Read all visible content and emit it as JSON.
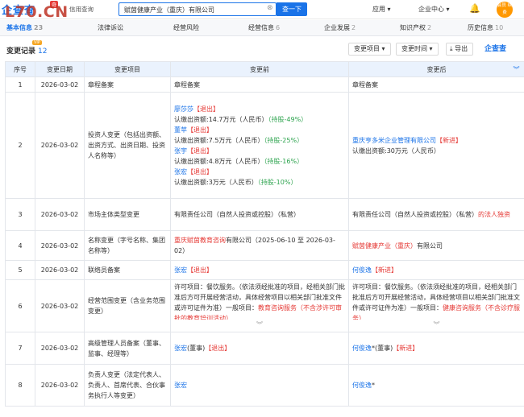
{
  "watermark": "L70.CN",
  "header": {
    "logo": "企查查",
    "logo_badge": "奇",
    "credit_label": "信用查询",
    "search_value": "赋茵健康产业（重庆）有限公司",
    "search_button": "查一下",
    "app_label": "应用 ▾",
    "enterprise_center": "企业中心 ▾",
    "member_badge": "会员 续费"
  },
  "tabs": [
    {
      "label": "基本信息",
      "count": "23",
      "active": true
    },
    {
      "label": "法律诉讼",
      "count": ""
    },
    {
      "label": "经营风险",
      "count": ""
    },
    {
      "label": "经营信息",
      "count": "6"
    },
    {
      "label": "企业发展",
      "count": "2"
    },
    {
      "label": "知识产权",
      "count": "2"
    },
    {
      "label": "历史信息",
      "count": "10"
    }
  ],
  "section": {
    "title": "变更记录",
    "count": "12",
    "vip": "VIP",
    "filter_type": "变更项目 ▾",
    "filter_time": "变更时间 ▾",
    "export": "导出",
    "brand": "企查查"
  },
  "table": {
    "headers": [
      "序号",
      "变更日期",
      "变更项目",
      "变更前",
      "变更后"
    ],
    "rows": [
      {
        "no": "1",
        "date": "2026-03-02",
        "item": "章程备案",
        "before": [
          {
            "t": "章程备案",
            "c": ""
          }
        ],
        "after": [
          {
            "t": "章程备案",
            "c": ""
          }
        ]
      },
      {
        "no": "2",
        "date": "2026-03-02",
        "item": "投资人变更（包括出资额、出资方式、出资日期、投资人名称等）",
        "before": [
          {
            "t": "廖莎莎",
            "c": "blue",
            "s": "【退出】"
          },
          {
            "t": "认缴出资额:14.7万元（人民币）",
            "c": "",
            "s": "（持股-49%）",
            "sc": "green"
          },
          {
            "t": "董苹",
            "c": "blue",
            "s": "【退出】"
          },
          {
            "t": "认缴出资额:7.5万元（人民币）",
            "c": "",
            "s": "（持股-25%）",
            "sc": "green"
          },
          {
            "t": "张宇",
            "c": "blue",
            "s": "【退出】"
          },
          {
            "t": "认缴出资额:4.8万元（人民币）",
            "c": "",
            "s": "（持股-16%）",
            "sc": "green"
          },
          {
            "t": "张宏",
            "c": "blue",
            "s": "【退出】"
          },
          {
            "t": "认缴出资额:3万元（人民币）",
            "c": "",
            "s": "（持股-10%）",
            "sc": "green"
          }
        ],
        "after": [
          {
            "t": "重庆亨多米企业管理有限公司",
            "c": "blue",
            "s": "【新进】"
          },
          {
            "t": "认缴出资额:30万元（人民币）",
            "c": ""
          }
        ]
      },
      {
        "no": "3",
        "date": "2026-03-02",
        "item": "市场主体类型变更",
        "before": [
          {
            "t": "有限责任公司（自然人投资或控股）（私营）",
            "c": ""
          }
        ],
        "after": [
          {
            "t": "有限责任公司（自然人投资或控股",
            "c": "",
            "s": "的法人独资",
            "sc": "red",
            "e": "）（私营）"
          }
        ]
      },
      {
        "no": "4",
        "date": "2026-03-02",
        "item": "名称变更（字号名称、集团名称等）",
        "before": [
          {
            "t": "重庆赋茵教育咨询",
            "c": "red",
            "e": "有限公司（2025-06-10 至 2026-03-02）"
          }
        ],
        "after": [
          {
            "t": "赋茵健康产业（重庆）",
            "c": "red",
            "e": "有限公司"
          }
        ]
      },
      {
        "no": "5",
        "date": "2026-03-02",
        "item": "联络员备案",
        "before": [
          {
            "t": "张宏",
            "c": "blue",
            "s": "【退出】"
          }
        ],
        "after": [
          {
            "t": "何俊逸",
            "c": "blue",
            "s": "【新进】"
          }
        ]
      },
      {
        "no": "6",
        "date": "2026-03-02",
        "item": "经营范围变更（含业务范围变更）",
        "before": [
          {
            "t": "许可项目：餐饮服务。（依法须经批准的项目，经相关部门批准后方可开展经营活动，具体经营项目以相关部门批准文件或许可证件为准）一般项目：",
            "c": "",
            "s": "教育咨询服务（不含涉许可审批的教育培训活动）",
            "sc": "red"
          }
        ],
        "after": [
          {
            "t": "许可项目：餐饮服务。（依法须经批准的项目，经相关部门批准后方可开展经营活动，具体经营项目以相关部门批准文件或许可证件为准）一般项目：",
            "c": "",
            "s": "健康咨询服务（不含诊疗服务）",
            "sc": "red"
          }
        ]
      },
      {
        "no": "7",
        "date": "2026-03-02",
        "item": "高级管理人员备案（董事、监事、经理等）",
        "before": [
          {
            "t": "张宏",
            "c": "blue",
            "e": "(董事)",
            "s2": "【退出】"
          }
        ],
        "after": [
          {
            "t": "何俊逸",
            "c": "blue",
            "e": "*(董事)",
            "s2": "【新进】"
          }
        ]
      },
      {
        "no": "8",
        "date": "2026-03-02",
        "item": "负责人变更（法定代表人、负责人、首席代表、合伙事务执行人等变更）",
        "before": [
          {
            "t": "张宏",
            "c": "blue"
          }
        ],
        "after": [
          {
            "t": "何俊逸",
            "c": "blue",
            "e": "*"
          }
        ]
      }
    ]
  },
  "colors": {
    "accent": "#1a73e8",
    "red": "#e53935",
    "green": "#2ea44f",
    "header_bg": "#eaf2fd"
  }
}
